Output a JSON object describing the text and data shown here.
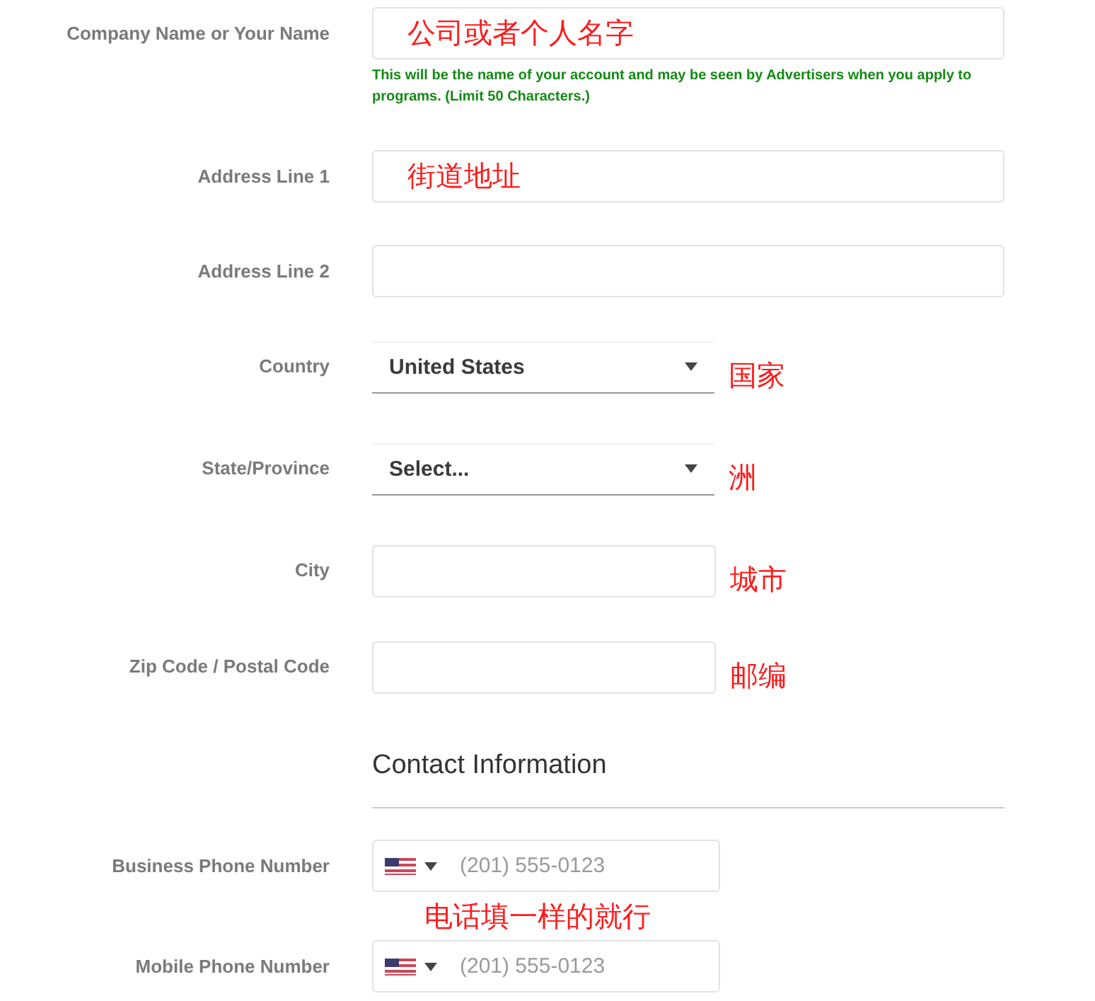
{
  "fields": [
    {
      "kind": "text",
      "label": "Company Name or Your Name",
      "annotation": "公司或者个人名字",
      "hint": "This will be the name of your account and may be seen by Advertisers when you apply to programs. (Limit 50 Characters.)"
    },
    {
      "kind": "text",
      "label": "Address Line 1",
      "annotation": "街道地址"
    },
    {
      "kind": "text",
      "label": "Address Line 2"
    },
    {
      "kind": "select",
      "label": "Country",
      "value": "United States",
      "annotation": "国家"
    },
    {
      "kind": "select",
      "label": "State/Province",
      "value": "Select...",
      "annotation": "洲"
    },
    {
      "kind": "short",
      "label": "City",
      "annotation": "城市"
    },
    {
      "kind": "short",
      "label": "Zip Code / Postal Code",
      "annotation": "邮编"
    },
    {
      "kind": "heading",
      "text": "Contact Information"
    },
    {
      "kind": "phone",
      "label": "Business Phone Number",
      "placeholder": "(201) 555-0123"
    },
    {
      "kind": "note",
      "annotation": "电话填一样的就行"
    },
    {
      "kind": "phone",
      "label": "Mobile Phone Number",
      "placeholder": "(201) 555-0123"
    }
  ]
}
